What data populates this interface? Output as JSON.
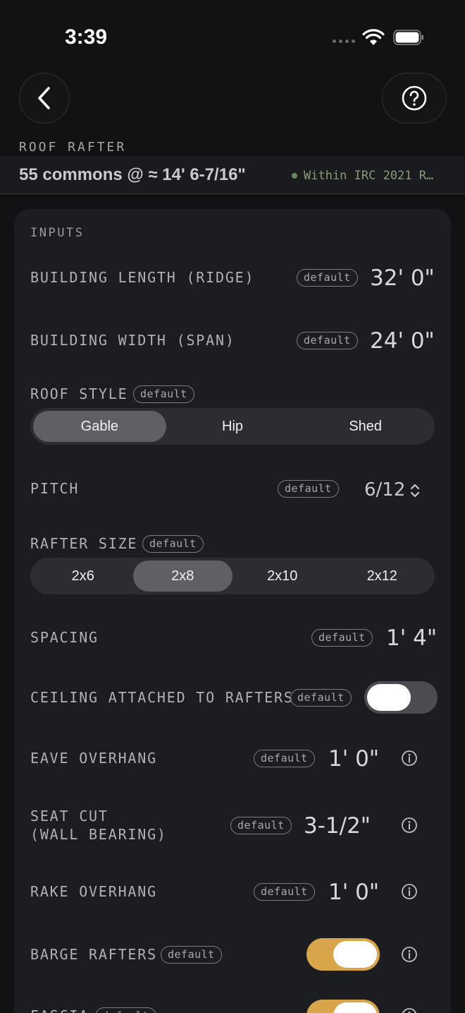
{
  "status_bar": {
    "time": "3:39"
  },
  "header": {
    "section_label": "ROOF RAFTER",
    "summary": "55 commons @ ≈ 14' 6-7/16\"",
    "status": "Within IRC 2021 R…",
    "status_color": "#6b8a5a"
  },
  "inputs": {
    "title": "INPUTS",
    "default_chip": "default",
    "building_length": {
      "label": "BUILDING LENGTH (RIDGE)",
      "value": "32' 0\""
    },
    "building_width": {
      "label": "BUILDING WIDTH (SPAN)",
      "value": "24' 0\""
    },
    "roof_style": {
      "label": "ROOF STYLE",
      "options": [
        "Gable",
        "Hip",
        "Shed"
      ],
      "selected": "Gable"
    },
    "pitch": {
      "label": "PITCH",
      "value": "6/12"
    },
    "rafter_size": {
      "label": "RAFTER SIZE",
      "options": [
        "2x6",
        "2x8",
        "2x10",
        "2x12"
      ],
      "selected": "2x8"
    },
    "spacing": {
      "label": "SPACING",
      "value": "1' 4\""
    },
    "ceiling_attached": {
      "label": "CEILING ATTACHED TO RAFTERS",
      "on": false
    },
    "eave_overhang": {
      "label": "EAVE OVERHANG",
      "value": "1' 0\""
    },
    "seat_cut": {
      "label_line1": "SEAT CUT",
      "label_line2": "(WALL BEARING)",
      "value": "3-1/2\""
    },
    "rake_overhang": {
      "label": "RAKE OVERHANG",
      "value": "1' 0\""
    },
    "barge_rafters": {
      "label": "BARGE RAFTERS",
      "on": true
    },
    "fascia": {
      "label": "FASCIA",
      "on": true
    }
  },
  "colors": {
    "accent": "#d9a54a",
    "background": "#111214",
    "card": "#1c1d20"
  },
  "icons": {
    "back": "chevron-left-icon",
    "help": "question-circle-icon",
    "info": "info-icon",
    "stepper": "chevron-up-down-icon"
  }
}
